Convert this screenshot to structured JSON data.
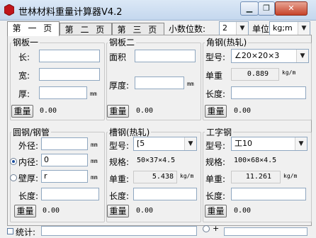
{
  "window": {
    "title": "世林材料重量计算器V4.2",
    "minimize_label": "▁",
    "restore_label": "❐",
    "close_label": "✕"
  },
  "tabs": [
    {
      "label": "第 一 页"
    },
    {
      "label": "第 二 页"
    },
    {
      "label": "第 三 页"
    }
  ],
  "settings": {
    "decimal_label": "小数位数:",
    "decimal_value": "2",
    "unit_label": "单位制:",
    "unit_value": "kg;m"
  },
  "steel_plate_1": {
    "title": "钢板一",
    "length_label": "长:",
    "width_label": "宽:",
    "thickness_label": "厚:",
    "thickness_unit": "mm",
    "weight_button": "重量",
    "result": "0.00"
  },
  "steel_plate_2": {
    "title": "钢板二",
    "area_label": "面积",
    "thickness_label": "厚度:",
    "thickness_unit": "mm",
    "weight_button": "重量",
    "result": "0.00"
  },
  "angle_steel": {
    "title": "角钢(热轧)",
    "model_label": "型号:",
    "model_value": "∠20×20×3",
    "unit_weight_label": "单重",
    "unit_weight_value": "0.889",
    "unit_weight_unit": "kg/m",
    "length_label": "长度:",
    "weight_button": "重量",
    "result": "0.00"
  },
  "round_steel": {
    "title": "圆钢/钢管",
    "outer_label": "外径:",
    "outer_unit": "mm",
    "inner_label": "内径:",
    "inner_value": "0",
    "inner_unit": "mm",
    "wall_label": "壁厚:",
    "wall_value": "r",
    "wall_unit": "mm",
    "length_label": "长度:",
    "weight_button": "重量",
    "result": "0.00"
  },
  "channel_steel": {
    "title": "槽钢(热轧)",
    "model_label": "型号:",
    "model_value": "[5",
    "spec_label": "规格:",
    "spec_value": "50×37×4.5",
    "unit_weight_label": "单重:",
    "unit_weight_value": "5.438",
    "unit_weight_unit": "kg/m",
    "length_label": "长度:",
    "weight_button": "重量",
    "result": "0.00"
  },
  "i_beam": {
    "title": "工字钢",
    "model_label": "型号:",
    "model_value": "工10",
    "spec_label": "规格:",
    "spec_value": "100×68×4.5",
    "unit_weight_label": "单重:",
    "unit_weight_value": "11.261",
    "unit_weight_unit": "kg/m",
    "length_label": "长度:",
    "weight_button": "重量",
    "result": "0.00"
  },
  "bottom": {
    "total_label": "统计:",
    "plus_label": "+"
  }
}
